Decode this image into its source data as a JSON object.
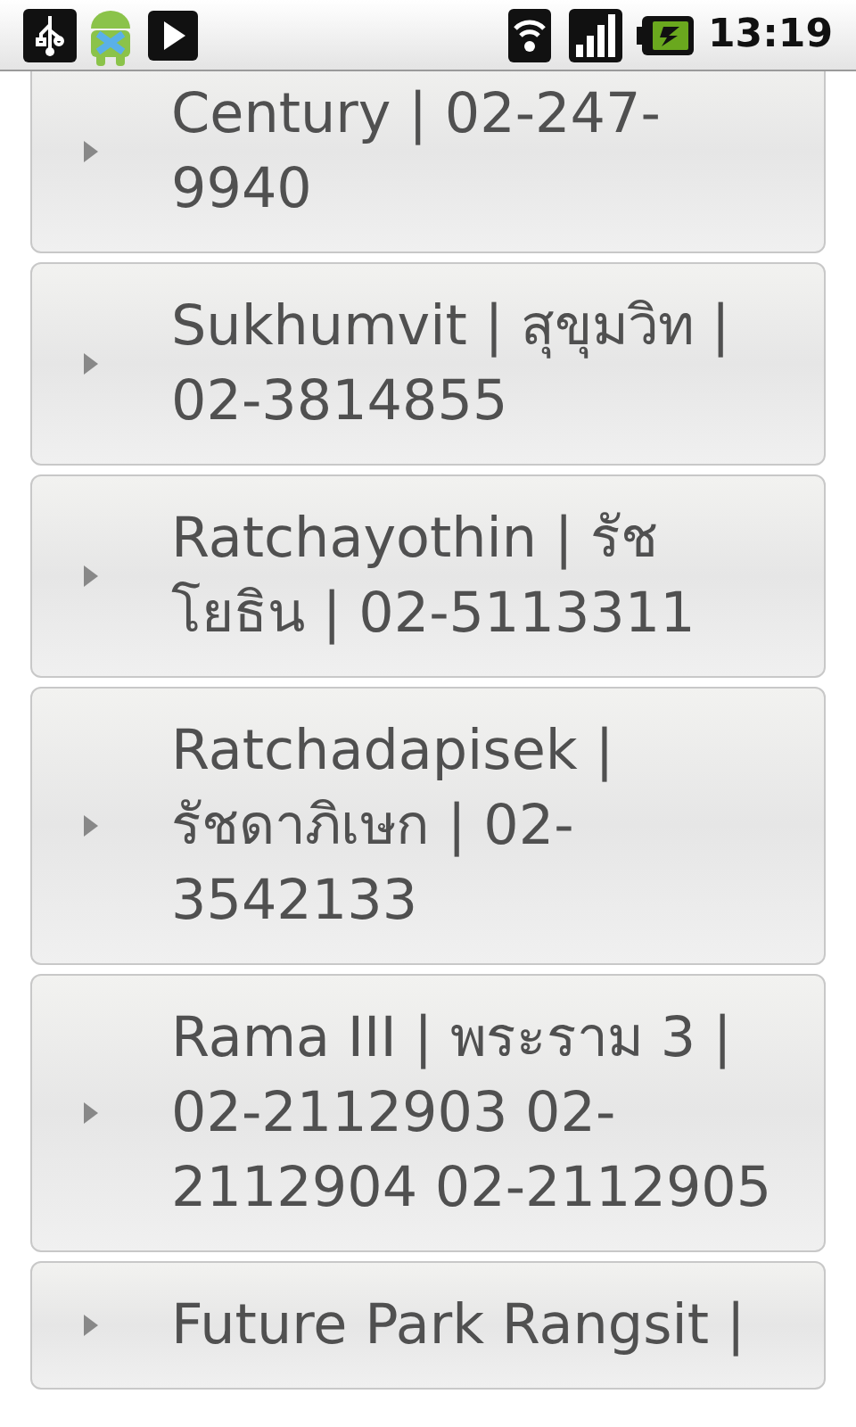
{
  "status_bar": {
    "time": "13:19"
  },
  "items": [
    {
      "text": "Century | 02-247-9940"
    },
    {
      "text": "Sukhumvit | สุขุมวิท | 02-3814855"
    },
    {
      "text": "Ratchayothin | รัชโยธิน | 02-5113311"
    },
    {
      "text": "Ratchadapisek | รัชดาภิเษก | 02-3542133"
    },
    {
      "text": "Rama III | พระราม 3 | 02-2112903 02-2112904 02-2112905"
    },
    {
      "text": "Future Park Rangsit |"
    }
  ]
}
